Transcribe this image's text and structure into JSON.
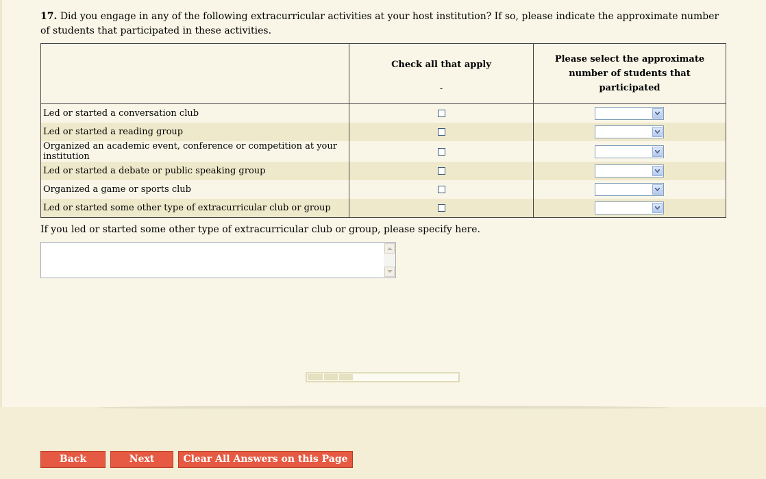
{
  "question": {
    "number": "17.",
    "text": "Did you engage in any of the following extracurricular activities at your host institution? If so, please indicate the approximate number of students that participated in these activities."
  },
  "table": {
    "header_check": "Check all that apply",
    "header_dash": "-",
    "header_count": "Please select the approximate number of students that participated",
    "rows": [
      {
        "label": "Led or started a conversation club",
        "selected": ""
      },
      {
        "label": "Led or started a reading group",
        "selected": ""
      },
      {
        "label": "Organized an academic event, conference or competition at your institution",
        "selected": ""
      },
      {
        "label": "Led or started a debate or public speaking group",
        "selected": ""
      },
      {
        "label": "Organized a game or sports club",
        "selected": ""
      },
      {
        "label": "Led or started some other type of extracurricular club or group",
        "selected": ""
      }
    ]
  },
  "specify": {
    "label": "If you led or started some other type of extracurricular club or group, please specify here.",
    "value": ""
  },
  "progress": {
    "fraction": 0.3
  },
  "buttons": {
    "back": "Back",
    "next": "Next",
    "clear": "Clear All Answers on this Page"
  },
  "colors": {
    "button_bg": "#e65a43",
    "row_alt": "#efe9cb",
    "page_bg": "#f9f6e8"
  }
}
